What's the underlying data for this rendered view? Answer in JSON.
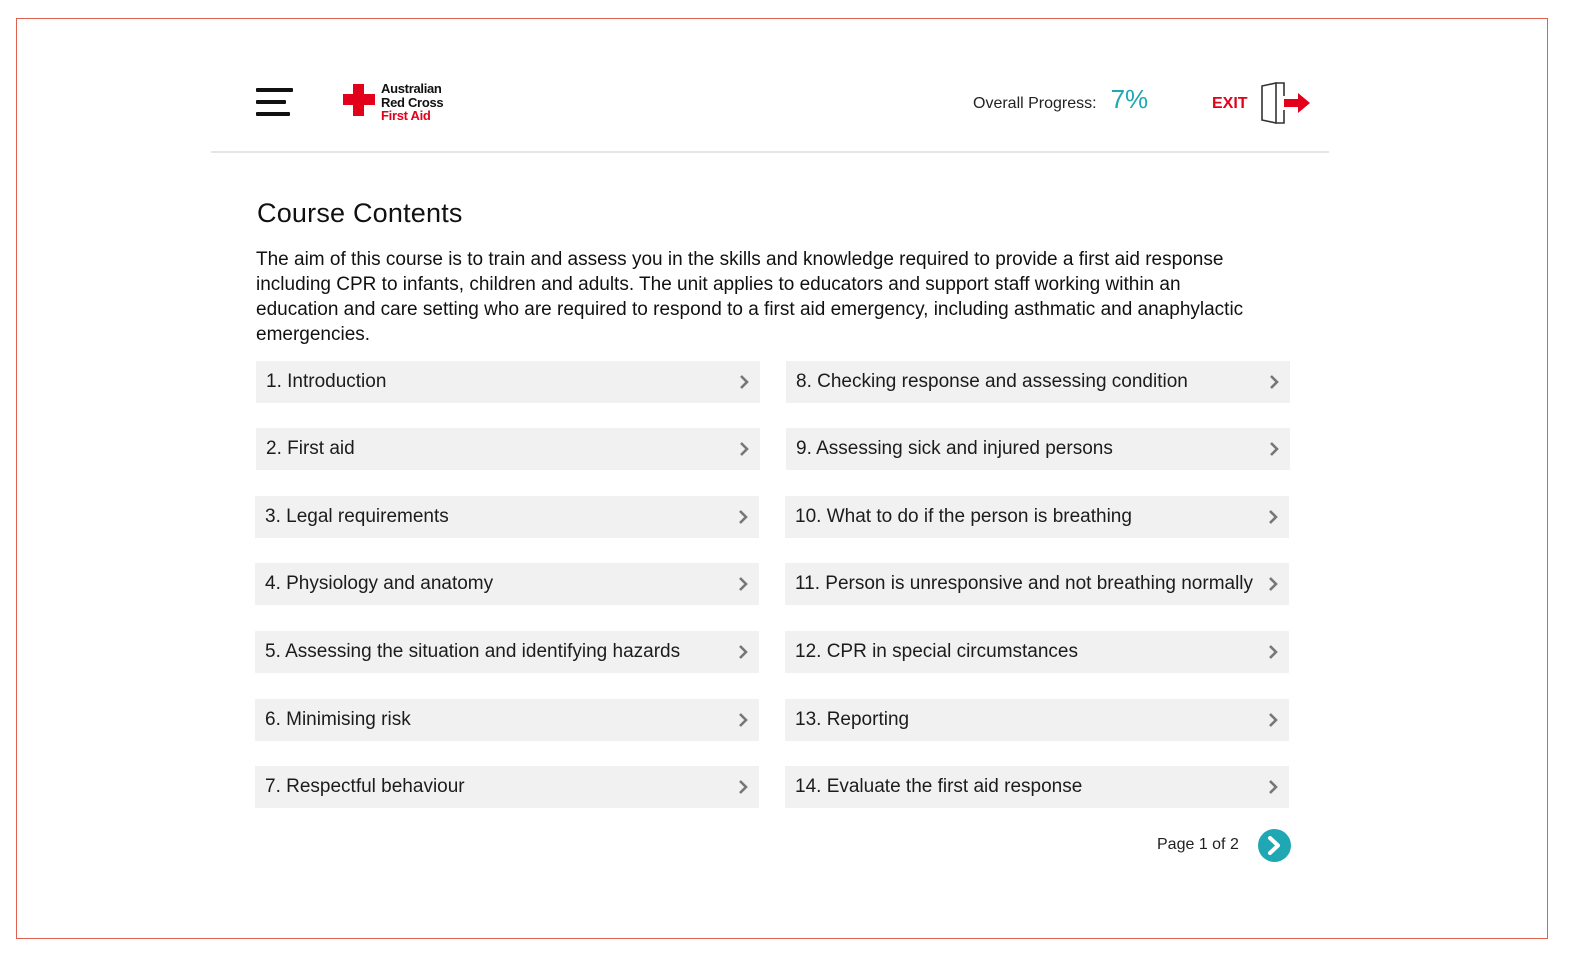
{
  "header": {
    "menu_icon": "hamburger-menu-icon",
    "logo": {
      "line1": "Australian",
      "line2": "Red Cross",
      "line3": "First Aid",
      "icon": "red-cross-icon"
    },
    "progress_label": "Overall Progress:",
    "progress_value": "7%",
    "exit_label": "EXIT",
    "exit_icon": "exit-door-icon"
  },
  "main": {
    "title": "Course Contents",
    "description": "The aim of this course is to train and assess you in the skills and knowledge required to provide a first aid response including CPR to infants, children and adults. The unit applies to educators and support staff working within an education and care setting who are required to respond to a first aid emergency, including asthmatic and anaphylactic emergencies.",
    "left_items": [
      "1. Introduction",
      "2. First aid",
      "3. Legal requirements",
      "4. Physiology and anatomy",
      "5. Assessing the situation and identifying hazards",
      "6. Minimising risk",
      "7. Respectful behaviour"
    ],
    "right_items": [
      "8. Checking response and assessing condition",
      "9. Assessing sick and injured persons",
      "10. What to do if the person is breathing",
      "11. Person is unresponsive and not breathing normally",
      "12. CPR in special circumstances",
      "13. Reporting",
      "14. Evaluate the first aid response"
    ]
  },
  "footer": {
    "page_label": "Page 1 of 2",
    "next_icon": "chevron-right-icon"
  },
  "colors": {
    "brand_red": "#e3001b",
    "accent_teal": "#1fa7b4",
    "item_bg": "#f1f1f1"
  }
}
